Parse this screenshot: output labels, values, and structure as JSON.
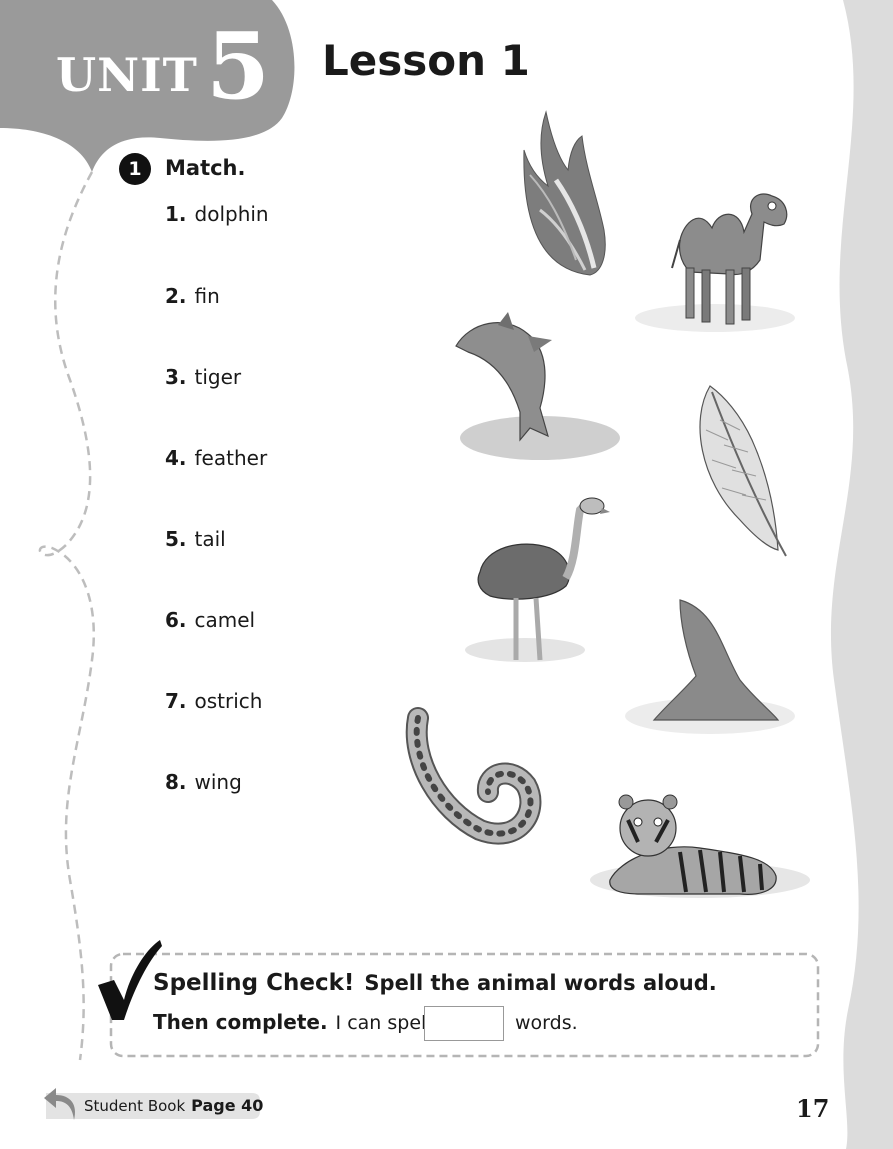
{
  "header": {
    "unit_label": "UNIT",
    "unit_number": "5",
    "lesson_title": "Lesson 1"
  },
  "exercise": {
    "number": "1",
    "instruction": "Match.",
    "items": [
      {
        "num": "1.",
        "word": "dolphin"
      },
      {
        "num": "2.",
        "word": "fin"
      },
      {
        "num": "3.",
        "word": "tiger"
      },
      {
        "num": "4.",
        "word": "feather"
      },
      {
        "num": "5.",
        "word": "tail"
      },
      {
        "num": "6.",
        "word": "camel"
      },
      {
        "num": "7.",
        "word": "ostrich"
      },
      {
        "num": "8.",
        "word": "wing"
      }
    ],
    "pictures": [
      "wing-illustration",
      "camel-illustration",
      "dolphin-illustration",
      "feather-illustration",
      "ostrich-illustration",
      "fin-illustration",
      "tail-illustration",
      "tiger-illustration"
    ]
  },
  "spelling_check": {
    "title": "Spelling Check!",
    "instruction": "Spell the animal words aloud.",
    "then": "Then complete.",
    "prefix": "I can spell",
    "answer": "",
    "suffix": "words."
  },
  "footer": {
    "book_label": "Student Book",
    "page_ref": "Page 40",
    "page_number": "17"
  },
  "colors": {
    "header_gray": "#9a9a9a",
    "side_band": "#d9d9d9",
    "dash": "#bdbdbd"
  }
}
